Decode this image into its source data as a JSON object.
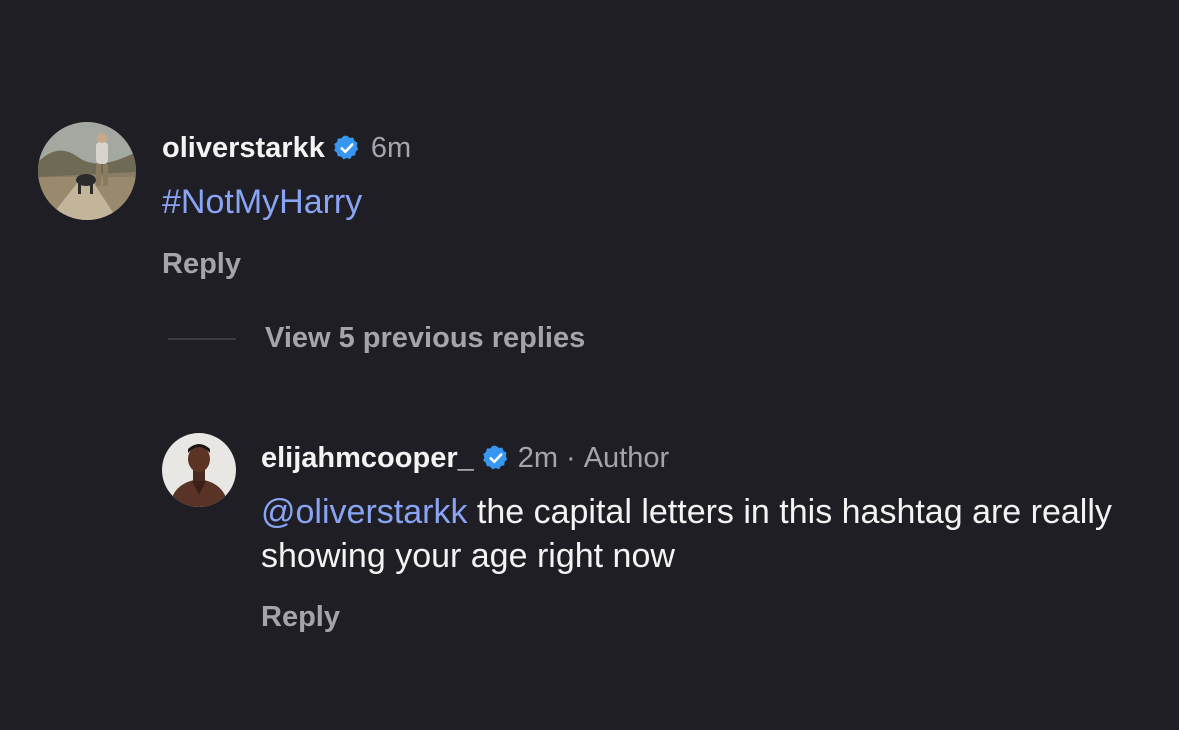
{
  "comment": {
    "username": "oliverstarkk",
    "time": "6m",
    "hashtag": "#NotMyHarry",
    "reply_label": "Reply",
    "avatar_icon": "avatar-photo-man-with-dog"
  },
  "view_replies": {
    "label": "View 5 previous replies"
  },
  "reply": {
    "username": "elijahmcooper_",
    "time": "2m",
    "separator": "·",
    "role": "Author",
    "mention": "@oliverstarkk",
    "text": " the capital letters in this hashtag are really showing your age right now",
    "reply_label": "Reply",
    "avatar_icon": "avatar-photo-man-portrait"
  },
  "colors": {
    "background": "#1f1e25",
    "link": "#8aa4f4",
    "verified": "#3797f0",
    "muted": "#a4a4ab"
  }
}
